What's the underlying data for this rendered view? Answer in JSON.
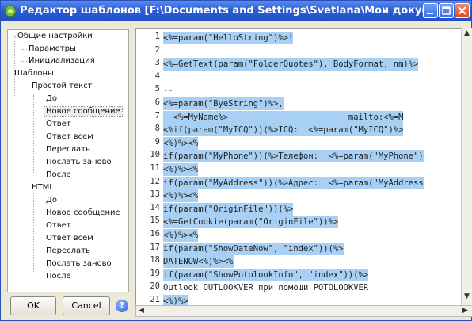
{
  "window": {
    "title": "Редактор шаблонов [F:\\Documents and Settings\\Svetlana\\Мои документы\\My Temp..."
  },
  "tree": {
    "items": [
      {
        "label": "Общие настройки"
      },
      {
        "label": "Параметры"
      },
      {
        "label": "Инициализация"
      },
      {
        "label": "Шаблоны"
      },
      {
        "label": "Простой текст"
      },
      {
        "label": "До"
      },
      {
        "label": "Новое сообщение"
      },
      {
        "label": "Ответ"
      },
      {
        "label": "Ответ всем"
      },
      {
        "label": "Переслать"
      },
      {
        "label": "Послать заново"
      },
      {
        "label": "После"
      },
      {
        "label": "HTML"
      },
      {
        "label": "До"
      },
      {
        "label": "Новое сообщение"
      },
      {
        "label": "Ответ"
      },
      {
        "label": "Ответ всем"
      },
      {
        "label": "Переслать"
      },
      {
        "label": "Послать заново"
      },
      {
        "label": "После"
      }
    ]
  },
  "buttons": {
    "ok": "OK",
    "cancel": "Cancel",
    "help": "?"
  },
  "editor": {
    "lines": [
      {
        "n": "1",
        "text": "<%=param(\"HelloString\")%>!"
      },
      {
        "n": "2",
        "text": ""
      },
      {
        "n": "3",
        "text": "<%=GetText(param(\"FolderQuotes\"), BodyFormat, nm)%>"
      },
      {
        "n": "4",
        "text": ""
      },
      {
        "n": "5",
        "text": "--"
      },
      {
        "n": "6",
        "text": "<%=param(\"ByeString\")%>,"
      },
      {
        "n": "7",
        "text": "  <%=MyName%>                        mailto:<%=M"
      },
      {
        "n": "8",
        "text": "<%if(param(\"MyICQ\"))(%>ICQ:  <%=param(\"MyICQ\")%>"
      },
      {
        "n": "9",
        "text": "<%)%><%"
      },
      {
        "n": "10",
        "text": "if(param(\"MyPhone\"))(%>Телефон:  <%=param(\"MyPhone\")"
      },
      {
        "n": "11",
        "text": "<%)%><%"
      },
      {
        "n": "12",
        "text": "if(param(\"MyAddress\"))(%>Адрес:  <%=param(\"MyAddress"
      },
      {
        "n": "13",
        "text": "<%)%><%"
      },
      {
        "n": "14",
        "text": "if(param(\"OriginFile\"))(%>"
      },
      {
        "n": "15",
        "text": "<%=GetCookie(param(\"OriginFile\"))%>"
      },
      {
        "n": "16",
        "text": "<%)%><%"
      },
      {
        "n": "17",
        "text": "if(param(\"ShowDateNow\", \"index\"))(%>"
      },
      {
        "n": "18",
        "text": "DATENOW<%)%><%"
      },
      {
        "n": "19",
        "text": "if(param(\"ShowPotolookInfo\", \"index\"))(%>"
      },
      {
        "n": "20",
        "text": "Outlook OUTLOOKVER при помощи POTOLOOKVER"
      },
      {
        "n": "21",
        "text": "<%)%>"
      }
    ]
  }
}
